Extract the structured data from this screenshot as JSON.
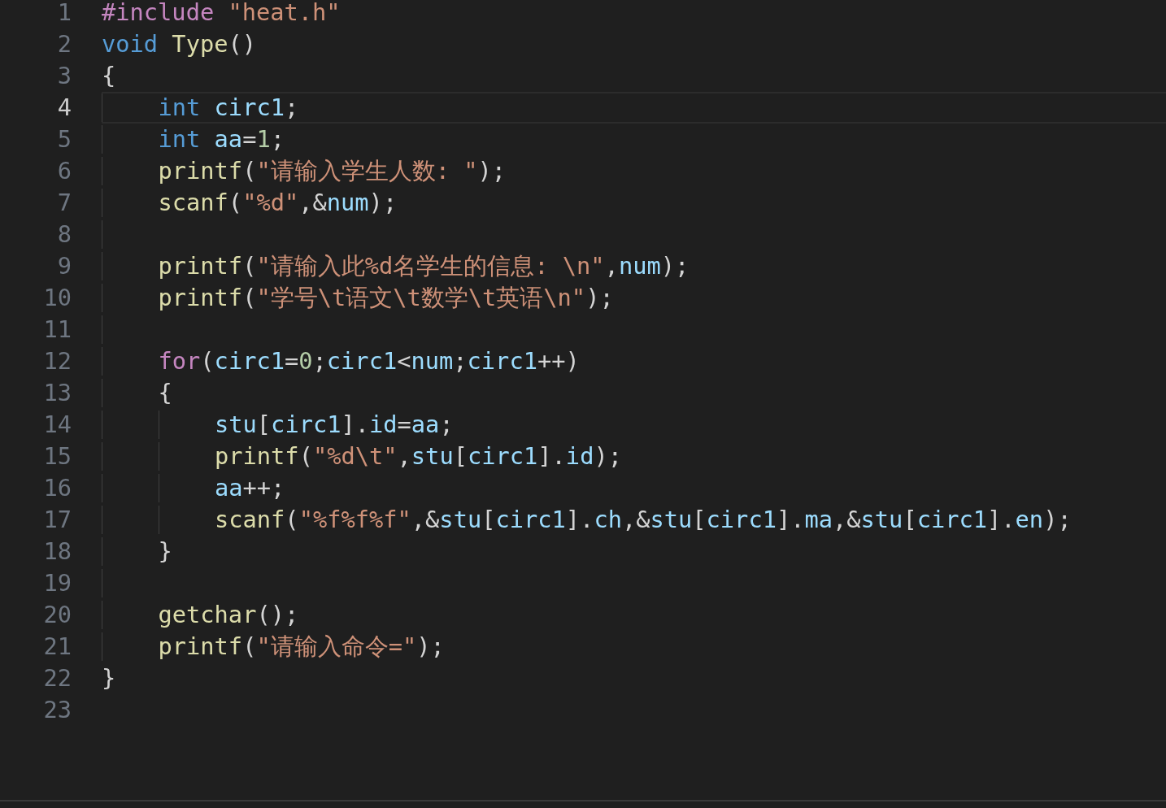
{
  "editor": {
    "lines": [
      {
        "number": "1",
        "current": false,
        "tokens": [
          {
            "text": "#include ",
            "kind": "control"
          },
          {
            "text": "\"heat.h\"",
            "kind": "string"
          }
        ]
      },
      {
        "number": "2",
        "current": false,
        "tokens": [
          {
            "text": "void ",
            "kind": "keyword"
          },
          {
            "text": "Type",
            "kind": "function"
          },
          {
            "text": "()",
            "kind": "punct"
          }
        ]
      },
      {
        "number": "3",
        "current": false,
        "tokens": [
          {
            "text": "{",
            "kind": "punct"
          }
        ],
        "children": [
          {
            "number": "4",
            "current": true,
            "tokens": [
              {
                "text": "int ",
                "kind": "keyword"
              },
              {
                "text": "circ1",
                "kind": "variable"
              },
              {
                "text": ";",
                "kind": "punct"
              }
            ]
          },
          {
            "number": "5",
            "current": false,
            "tokens": [
              {
                "text": "int ",
                "kind": "keyword"
              },
              {
                "text": "aa",
                "kind": "variable"
              },
              {
                "text": "=",
                "kind": "punct"
              },
              {
                "text": "1",
                "kind": "number"
              },
              {
                "text": ";",
                "kind": "punct"
              }
            ]
          },
          {
            "number": "6",
            "current": false,
            "tokens": [
              {
                "text": "printf",
                "kind": "function"
              },
              {
                "text": "(",
                "kind": "punct"
              },
              {
                "text": "\"请输入学生人数: \"",
                "kind": "string"
              },
              {
                "text": ");",
                "kind": "punct"
              }
            ]
          },
          {
            "number": "7",
            "current": false,
            "tokens": [
              {
                "text": "scanf",
                "kind": "function"
              },
              {
                "text": "(",
                "kind": "punct"
              },
              {
                "text": "\"%d\"",
                "kind": "string"
              },
              {
                "text": ",&",
                "kind": "punct"
              },
              {
                "text": "num",
                "kind": "variable"
              },
              {
                "text": ");",
                "kind": "punct"
              }
            ]
          },
          {
            "number": "8",
            "current": false
          },
          {
            "number": "9",
            "current": false,
            "tokens": [
              {
                "text": "printf",
                "kind": "function"
              },
              {
                "text": "(",
                "kind": "punct"
              },
              {
                "text": "\"请输入此%d名学生的信息: \\n\"",
                "kind": "string"
              },
              {
                "text": ",",
                "kind": "punct"
              },
              {
                "text": "num",
                "kind": "variable"
              },
              {
                "text": ");",
                "kind": "punct"
              }
            ]
          },
          {
            "number": "10",
            "current": false,
            "tokens": [
              {
                "text": "printf",
                "kind": "function"
              },
              {
                "text": "(",
                "kind": "punct"
              },
              {
                "text": "\"学号\\t语文\\t数学\\t英语\\n\"",
                "kind": "string"
              },
              {
                "text": ");",
                "kind": "punct"
              }
            ]
          },
          {
            "number": "11",
            "current": false
          },
          {
            "number": "12",
            "current": false,
            "tokens": [
              {
                "text": "for",
                "kind": "control"
              },
              {
                "text": "(",
                "kind": "punct"
              },
              {
                "text": "circ1",
                "kind": "variable"
              },
              {
                "text": "=",
                "kind": "punct"
              },
              {
                "text": "0",
                "kind": "number"
              },
              {
                "text": ";",
                "kind": "punct"
              },
              {
                "text": "circ1",
                "kind": "variable"
              },
              {
                "text": "<",
                "kind": "punct"
              },
              {
                "text": "num",
                "kind": "variable"
              },
              {
                "text": ";",
                "kind": "punct"
              },
              {
                "text": "circ1",
                "kind": "variable"
              },
              {
                "text": "++)",
                "kind": "punct"
              }
            ]
          },
          {
            "number": "13",
            "current": false,
            "tokens": [
              {
                "text": "{",
                "kind": "punct"
              }
            ],
            "children": [
              {
                "number": "14",
                "current": false,
                "tokens": [
                  {
                    "text": "stu",
                    "kind": "variable"
                  },
                  {
                    "text": "[",
                    "kind": "punct"
                  },
                  {
                    "text": "circ1",
                    "kind": "variable"
                  },
                  {
                    "text": "].",
                    "kind": "punct"
                  },
                  {
                    "text": "id",
                    "kind": "variable"
                  },
                  {
                    "text": "=",
                    "kind": "punct"
                  },
                  {
                    "text": "aa",
                    "kind": "variable"
                  },
                  {
                    "text": ";",
                    "kind": "punct"
                  }
                ]
              },
              {
                "number": "15",
                "current": false,
                "tokens": [
                  {
                    "text": "printf",
                    "kind": "function"
                  },
                  {
                    "text": "(",
                    "kind": "punct"
                  },
                  {
                    "text": "\"%d\\t\"",
                    "kind": "string"
                  },
                  {
                    "text": ",",
                    "kind": "punct"
                  },
                  {
                    "text": "stu",
                    "kind": "variable"
                  },
                  {
                    "text": "[",
                    "kind": "punct"
                  },
                  {
                    "text": "circ1",
                    "kind": "variable"
                  },
                  {
                    "text": "].",
                    "kind": "punct"
                  },
                  {
                    "text": "id",
                    "kind": "variable"
                  },
                  {
                    "text": ");",
                    "kind": "punct"
                  }
                ]
              },
              {
                "number": "16",
                "current": false,
                "tokens": [
                  {
                    "text": "aa",
                    "kind": "variable"
                  },
                  {
                    "text": "++;",
                    "kind": "punct"
                  }
                ]
              },
              {
                "number": "17",
                "current": false,
                "tokens": [
                  {
                    "text": "scanf",
                    "kind": "function"
                  },
                  {
                    "text": "(",
                    "kind": "punct"
                  },
                  {
                    "text": "\"%f%f%f\"",
                    "kind": "string"
                  },
                  {
                    "text": ",&",
                    "kind": "punct"
                  },
                  {
                    "text": "stu",
                    "kind": "variable"
                  },
                  {
                    "text": "[",
                    "kind": "punct"
                  },
                  {
                    "text": "circ1",
                    "kind": "variable"
                  },
                  {
                    "text": "].",
                    "kind": "punct"
                  },
                  {
                    "text": "ch",
                    "kind": "variable"
                  },
                  {
                    "text": ",&",
                    "kind": "punct"
                  },
                  {
                    "text": "stu",
                    "kind": "variable"
                  },
                  {
                    "text": "[",
                    "kind": "punct"
                  },
                  {
                    "text": "circ1",
                    "kind": "variable"
                  },
                  {
                    "text": "].",
                    "kind": "punct"
                  },
                  {
                    "text": "ma",
                    "kind": "variable"
                  },
                  {
                    "text": ",&",
                    "kind": "punct"
                  },
                  {
                    "text": "stu",
                    "kind": "variable"
                  },
                  {
                    "text": "[",
                    "kind": "punct"
                  },
                  {
                    "text": "circ1",
                    "kind": "variable"
                  },
                  {
                    "text": "].",
                    "kind": "punct"
                  },
                  {
                    "text": "en",
                    "kind": "variable"
                  },
                  {
                    "text": ");",
                    "kind": "punct"
                  }
                ]
              }
            ]
          },
          {
            "number": "18",
            "current": false,
            "tokens": [
              {
                "text": "}",
                "kind": "punct"
              }
            ]
          },
          {
            "number": "19",
            "current": false
          },
          {
            "number": "20",
            "current": false,
            "tokens": [
              {
                "text": "getchar",
                "kind": "function"
              },
              {
                "text": "();",
                "kind": "punct"
              }
            ]
          },
          {
            "number": "21",
            "current": false,
            "tokens": [
              {
                "text": "printf",
                "kind": "function"
              },
              {
                "text": "(",
                "kind": "punct"
              },
              {
                "text": "\"请输入命令=\"",
                "kind": "string"
              },
              {
                "text": ");",
                "kind": "punct"
              }
            ]
          }
        ]
      },
      {
        "number": "22",
        "current": false,
        "tokens": [
          {
            "text": "}",
            "kind": "punct"
          }
        ]
      },
      {
        "number": "23",
        "current": false
      }
    ]
  }
}
